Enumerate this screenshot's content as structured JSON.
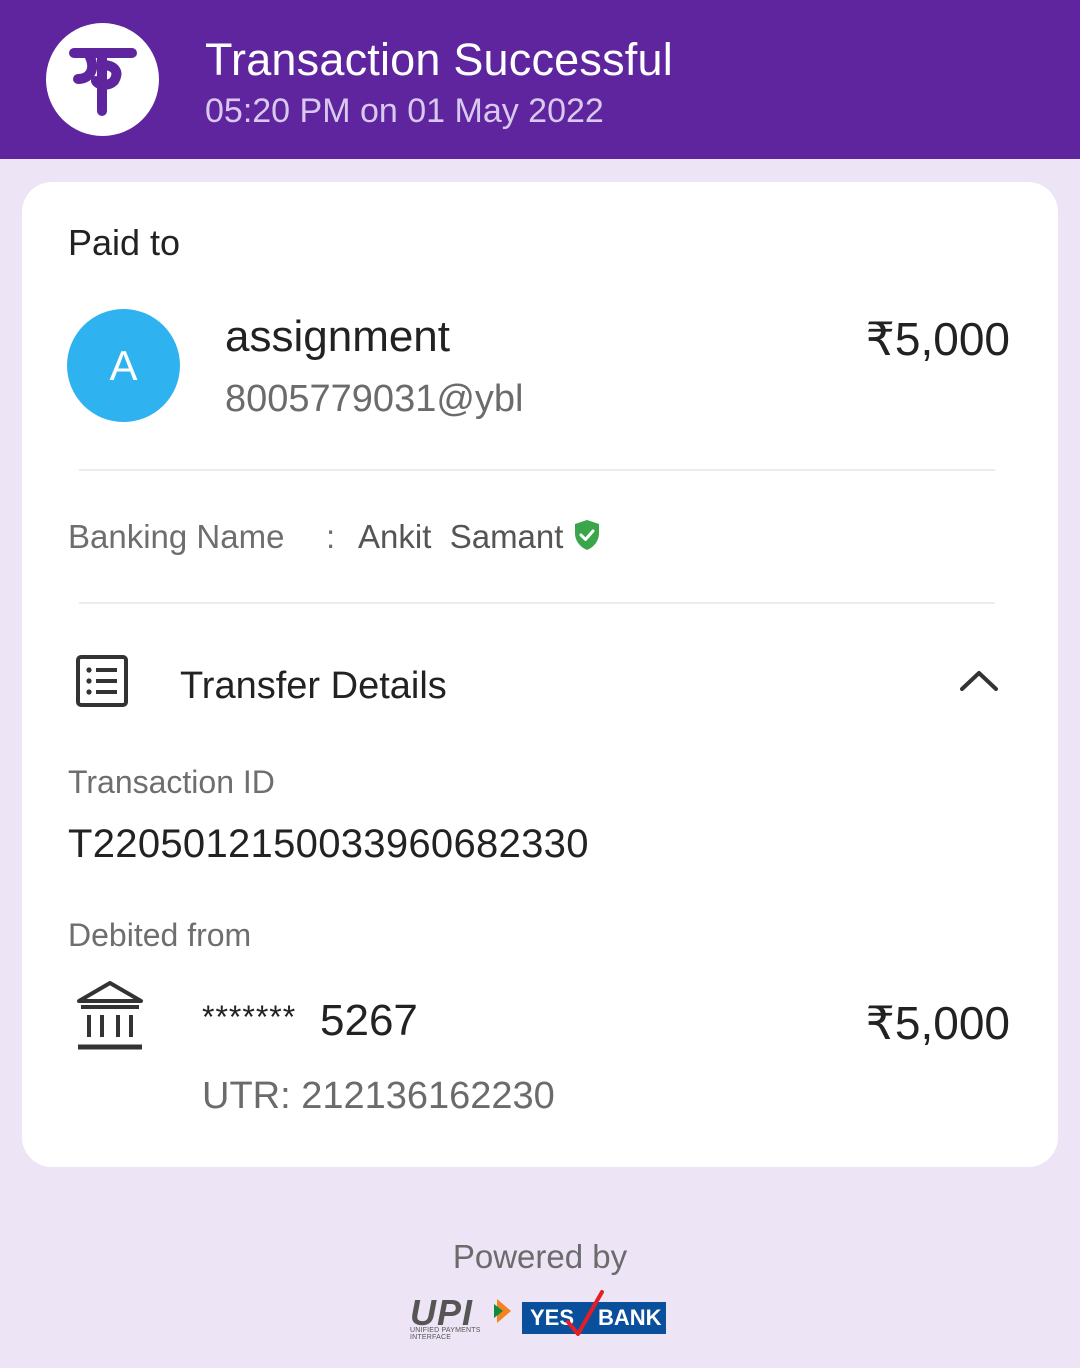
{
  "header": {
    "title": "Transaction Successful",
    "subtitle": "05:20 PM on 01 May 2022",
    "logo_glyph": "पे",
    "background": "#5f259f"
  },
  "payment": {
    "paid_to_label": "Paid to",
    "avatar_letter": "A",
    "avatar_color": "#2fb2f0",
    "payee_name": "assignment",
    "payee_vpa": "8005779031@ybl",
    "amount": "₹5,000"
  },
  "banking": {
    "label": "Banking Name",
    "separator": ":",
    "value": "Ankit  Samant",
    "verified_icon": "shield-check-icon",
    "verified_color": "#3aa54a"
  },
  "transfer_details": {
    "title": "Transfer Details",
    "icon": "receipt-list-icon",
    "toggle_icon": "chevron-up-icon",
    "transaction_id_label": "Transaction ID",
    "transaction_id": "T2205012150033960682330",
    "debited_from_label": "Debited from",
    "bank_icon": "bank-icon",
    "account_mask": "*******",
    "account_suffix": "5267",
    "debit_amount": "₹5,000",
    "utr": "UTR: 212136162230"
  },
  "footer": {
    "powered_by": "Powered by",
    "upi_logo_text": "UPI",
    "upi_logo_subtext": "UNIFIED PAYMENTS INTERFACE",
    "bank_logo_left": "YES",
    "bank_logo_right": "BANK"
  }
}
